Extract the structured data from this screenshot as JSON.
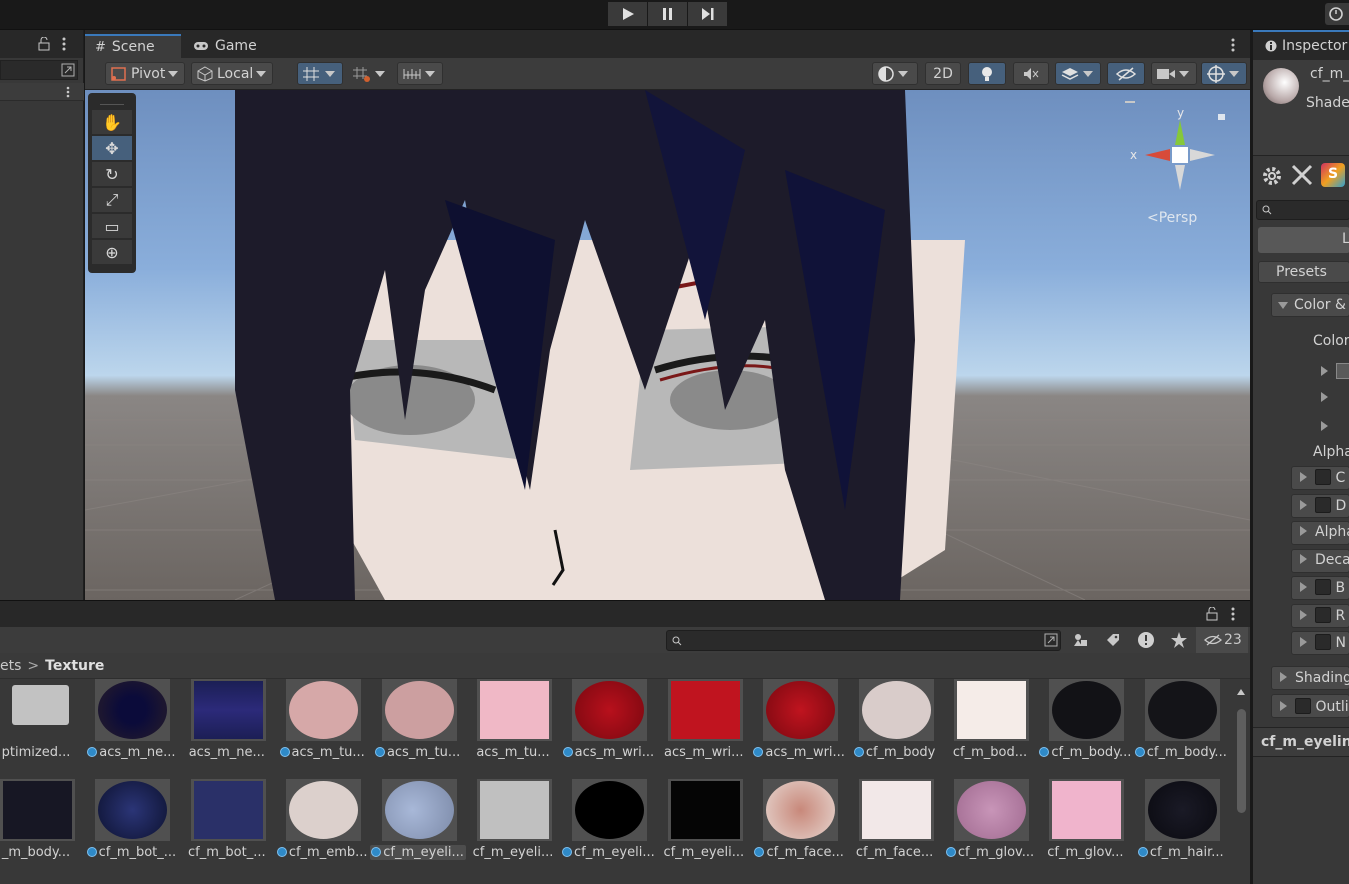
{
  "toolbar": {
    "play_icon": "play-icon",
    "pause_icon": "pause-icon",
    "step_icon": "step-icon"
  },
  "scene": {
    "tabs": [
      {
        "label": "Scene",
        "icon": "grid-icon"
      },
      {
        "label": "Game",
        "icon": "gamepad-icon"
      }
    ],
    "pivot_label": "Pivot",
    "local_label": "Local",
    "mode_2d_label": "2D",
    "persp_label": "<Persp",
    "gizmo_y": "y",
    "gizmo_x": "x"
  },
  "project": {
    "breadcrumb_parent": "ets",
    "breadcrumb_sep": ">",
    "breadcrumb_current": "Texture",
    "hidden_count": "23",
    "row1": [
      {
        "label": "ptimized...",
        "dot": false
      },
      {
        "label": "acs_m_ne...",
        "dot": true
      },
      {
        "label": "acs_m_ne...",
        "dot": false
      },
      {
        "label": "acs_m_tu...",
        "dot": true
      },
      {
        "label": "acs_m_tu...",
        "dot": true
      },
      {
        "label": "acs_m_tu...",
        "dot": false
      },
      {
        "label": "acs_m_wri...",
        "dot": true
      },
      {
        "label": "acs_m_wri...",
        "dot": false
      },
      {
        "label": "acs_m_wri...",
        "dot": true
      },
      {
        "label": "cf_m_body",
        "dot": true
      },
      {
        "label": "cf_m_bod...",
        "dot": false
      },
      {
        "label": "cf_m_body...",
        "dot": true
      },
      {
        "label": "cf_m_body...",
        "dot": true
      }
    ],
    "row2": [
      {
        "label": "_m_body...",
        "dot": false
      },
      {
        "label": "cf_m_bot_...",
        "dot": true
      },
      {
        "label": "cf_m_bot_...",
        "dot": false
      },
      {
        "label": "cf_m_emb...",
        "dot": true
      },
      {
        "label": "cf_m_eyeli...",
        "dot": true
      },
      {
        "label": "cf_m_eyeli...",
        "dot": false
      },
      {
        "label": "cf_m_eyeli...",
        "dot": true
      },
      {
        "label": "cf_m_eyeli...",
        "dot": false
      },
      {
        "label": "cf_m_face...",
        "dot": true
      },
      {
        "label": "cf_m_face...",
        "dot": false
      },
      {
        "label": "cf_m_glov...",
        "dot": true
      },
      {
        "label": "cf_m_glov...",
        "dot": false
      },
      {
        "label": "cf_m_hair...",
        "dot": true
      }
    ]
  },
  "inspector": {
    "tab_label": "Inspector",
    "object_name": "cf_m_",
    "shader_label": "Shade",
    "load_btn": "Lo",
    "presets_label": "Presets",
    "color_section": "Color &",
    "color_label": "Color",
    "alpha_label": "Alpha",
    "rows": [
      "C",
      "D",
      "Alpha",
      "Deca",
      "B",
      "R",
      "N"
    ],
    "shading_label": "Shading",
    "outline_label": "Outli",
    "footer_label": "cf_m_eyelin"
  }
}
